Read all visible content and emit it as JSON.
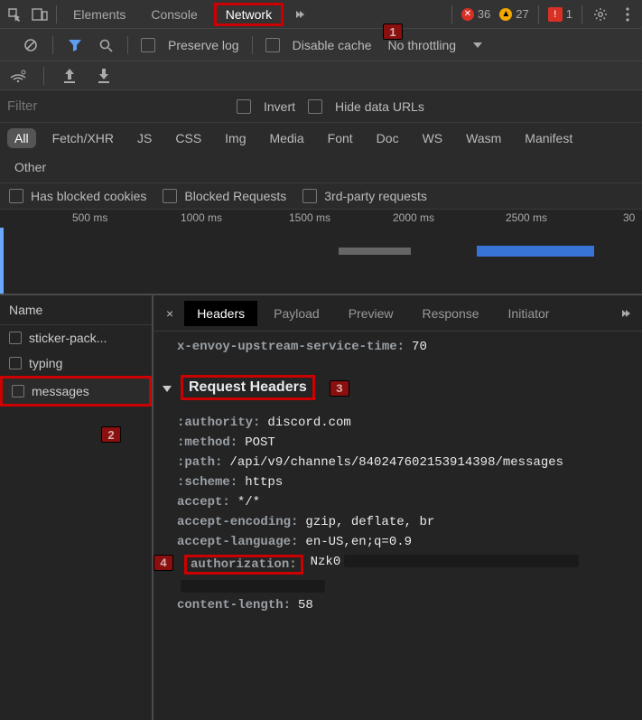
{
  "topTabs": {
    "elements": "Elements",
    "console": "Console",
    "network": "Network"
  },
  "status": {
    "errors": "36",
    "warnings": "27",
    "issues": "1"
  },
  "toolbar": {
    "preserveLog": "Preserve log",
    "disableCache": "Disable cache",
    "throttling": "No throttling"
  },
  "filter": {
    "placeholder": "Filter",
    "invert": "Invert",
    "hideDataUrls": "Hide data URLs"
  },
  "types": [
    "All",
    "Fetch/XHR",
    "JS",
    "CSS",
    "Img",
    "Media",
    "Font",
    "Doc",
    "WS",
    "Wasm",
    "Manifest",
    "Other"
  ],
  "checkrow": {
    "blockedCookies": "Has blocked cookies",
    "blockedRequests": "Blocked Requests",
    "thirdParty": "3rd-party requests"
  },
  "timeline": [
    "500 ms",
    "1000 ms",
    "1500 ms",
    "2000 ms",
    "2500 ms",
    "30"
  ],
  "leftcol": {
    "header": "Name"
  },
  "requests": [
    "sticker-pack...",
    "typing",
    "messages"
  ],
  "detailTabs": [
    "Headers",
    "Payload",
    "Preview",
    "Response",
    "Initiator"
  ],
  "responseHeaders": [
    {
      "k": "x-envoy-upstream-service-time:",
      "v": "70"
    }
  ],
  "requestHeadersTitle": "Request Headers",
  "requestHeaders": [
    {
      "k": ":authority:",
      "v": "discord.com"
    },
    {
      "k": ":method:",
      "v": "POST"
    },
    {
      "k": ":path:",
      "v": "/api/v9/channels/840247602153914398/messages"
    },
    {
      "k": ":scheme:",
      "v": "https"
    },
    {
      "k": "accept:",
      "v": "*/*"
    },
    {
      "k": "accept-encoding:",
      "v": "gzip, deflate, br"
    },
    {
      "k": "accept-language:",
      "v": "en-US,en;q=0.9"
    },
    {
      "k": "authorization:",
      "v": "Nzk0"
    },
    {
      "k": "content-length:",
      "v": "58"
    }
  ],
  "markers": {
    "m1": "1",
    "m2": "2",
    "m3": "3",
    "m4": "4"
  }
}
